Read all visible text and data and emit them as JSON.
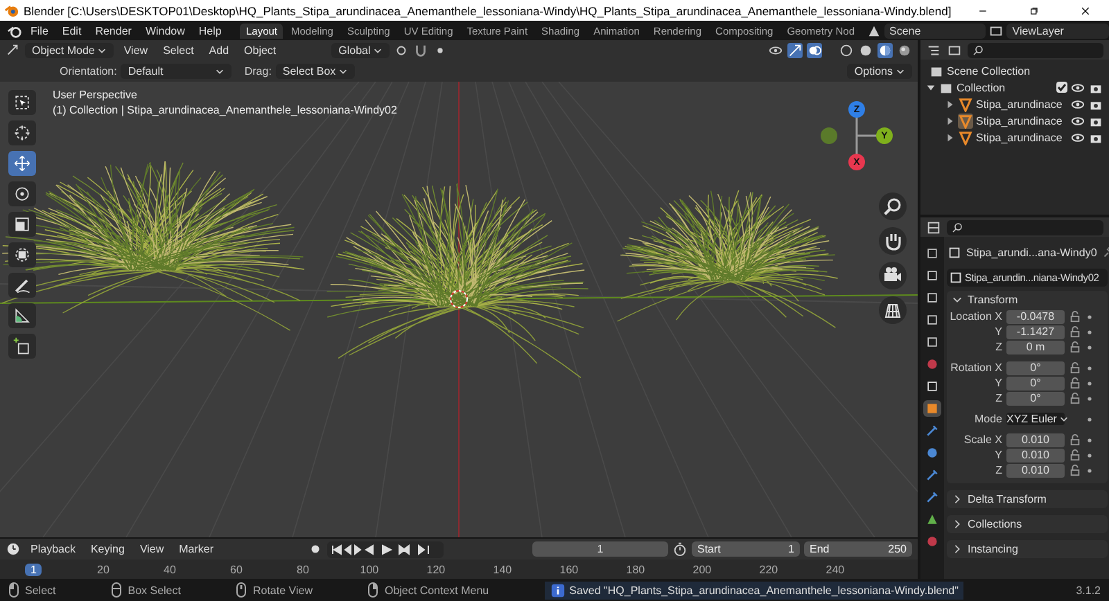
{
  "title_bar": {
    "title": "Blender [C:\\Users\\DESKTOP01\\Desktop\\HQ_Plants_Stipa_arundinacea_Anemanthele_lessoniana-Windy\\HQ_Plants_Stipa_arundinacea_Anemanthele_lessoniana-Windy.blend]"
  },
  "menu": [
    "File",
    "Edit",
    "Render",
    "Window",
    "Help"
  ],
  "workspaces": [
    {
      "label": "Layout",
      "selected": true
    },
    {
      "label": "Modeling",
      "selected": false
    },
    {
      "label": "Sculpting",
      "selected": false
    },
    {
      "label": "UV Editing",
      "selected": false
    },
    {
      "label": "Texture Paint",
      "selected": false
    },
    {
      "label": "Shading",
      "selected": false
    },
    {
      "label": "Animation",
      "selected": false
    },
    {
      "label": "Rendering",
      "selected": false
    },
    {
      "label": "Compositing",
      "selected": false
    },
    {
      "label": "Geometry Nod",
      "selected": false
    }
  ],
  "scene": "Scene",
  "view_layer": "ViewLayer",
  "viewport": {
    "mode": "Object Mode",
    "menus": [
      "View",
      "Select",
      "Add",
      "Object"
    ],
    "orientation": "Global",
    "shading": [
      {
        "kind": "wireframe",
        "selected": false
      },
      {
        "kind": "solid",
        "selected": false
      },
      {
        "kind": "material",
        "selected": true
      },
      {
        "kind": "rendered",
        "selected": false
      }
    ],
    "tool_settings": {
      "orientation_label": "Orientation:",
      "orientation": "Default",
      "drag_label": "Drag:",
      "drag": "Select Box",
      "options": "Options"
    },
    "view_name": "User Perspective",
    "object_info": "(1) Collection | Stipa_arundinacea_Anemanthele_lessoniana-Windy02",
    "tools": [
      {
        "kind": "select",
        "selected": false
      },
      {
        "kind": "cursor",
        "selected": false
      },
      {
        "kind": "move",
        "selected": true
      },
      {
        "kind": "rotate",
        "selected": false
      },
      {
        "kind": "scale",
        "selected": false
      },
      {
        "kind": "transform",
        "selected": false
      },
      {
        "kind": "annotate",
        "selected": false
      },
      {
        "kind": "measure",
        "selected": false
      },
      {
        "kind": "add-cube",
        "selected": false
      }
    ],
    "gizmo": [
      {
        "label": "Z",
        "color": "#2f7fe6"
      },
      {
        "label": "Y",
        "color": "#7fb01c"
      },
      {
        "label": "X",
        "color": "#e8374f"
      }
    ]
  },
  "outliner": {
    "tree": [
      {
        "label": "Scene Collection",
        "children": [
          {
            "label": "Collection",
            "expanded": true,
            "checked": true,
            "children": [
              {
                "label": "Stipa_arundinace",
                "selected": false
              },
              {
                "label": "Stipa_arundinace",
                "selected": true
              },
              {
                "label": "Stipa_arundinace",
                "selected": false
              }
            ]
          }
        ]
      }
    ]
  },
  "properties": {
    "tabs": [
      {
        "kind": "tool",
        "selected": false
      },
      {
        "kind": "render",
        "selected": false
      },
      {
        "kind": "output",
        "selected": false
      },
      {
        "kind": "view-layer",
        "selected": false
      },
      {
        "kind": "scene",
        "selected": false
      },
      {
        "kind": "world",
        "selected": false
      },
      {
        "kind": "collection",
        "selected": false
      },
      {
        "kind": "object",
        "selected": true
      },
      {
        "kind": "modifier",
        "selected": false
      },
      {
        "kind": "particles",
        "selected": false
      },
      {
        "kind": "physics",
        "selected": false
      },
      {
        "kind": "constraints",
        "selected": false
      },
      {
        "kind": "data",
        "selected": false
      },
      {
        "kind": "material",
        "selected": false
      }
    ],
    "object_name": "Stipa_arundi...ana-Windy0",
    "data_name": "Stipa_arundin...niana-Windy02",
    "transform": {
      "title": "Transform",
      "expanded": true,
      "groups": [
        [
          {
            "label": "Location X",
            "value": "-0.0478",
            "kind": "number"
          },
          {
            "label": "Y",
            "value": "-1.1427",
            "kind": "number"
          },
          {
            "label": "Z",
            "value": "0 m",
            "kind": "number"
          }
        ],
        [
          {
            "label": "Rotation X",
            "value": "0°",
            "kind": "number"
          },
          {
            "label": "Y",
            "value": "0°",
            "kind": "number"
          },
          {
            "label": "Z",
            "value": "0°",
            "kind": "number"
          }
        ],
        [
          {
            "label": "Mode",
            "value": "XYZ Euler",
            "kind": "enum"
          }
        ],
        [
          {
            "label": "Scale X",
            "value": "0.010",
            "kind": "number"
          },
          {
            "label": "Y",
            "value": "0.010",
            "kind": "number"
          },
          {
            "label": "Z",
            "value": "0.010",
            "kind": "number"
          }
        ]
      ]
    },
    "sections": [
      {
        "label": "Delta Transform",
        "expanded": false
      },
      {
        "label": "Collections",
        "expanded": false
      },
      {
        "label": "Instancing",
        "expanded": false
      }
    ]
  },
  "timeline": {
    "menus": [
      "Playback",
      "Keying",
      "View",
      "Marker"
    ],
    "frame": "1",
    "start_label": "Start",
    "start": "1",
    "end_label": "End",
    "end": "250",
    "current": "1",
    "ticks": [
      "20",
      "40",
      "60",
      "80",
      "100",
      "120",
      "140",
      "160",
      "180",
      "200",
      "220",
      "240"
    ]
  },
  "status_bar": {
    "items": [
      {
        "kind": "mouse-left",
        "label": "Select"
      },
      {
        "kind": "mouse-drag",
        "label": "Box Select"
      },
      {
        "kind": "mouse-middle",
        "label": "Rotate View"
      },
      {
        "kind": "mouse-right",
        "label": "Object Context Menu"
      }
    ],
    "message": "Saved \"HQ_Plants_Stipa_arundinacea_Anemanthele_lessoniana-Windy.blend\"",
    "version": "3.1.2"
  }
}
